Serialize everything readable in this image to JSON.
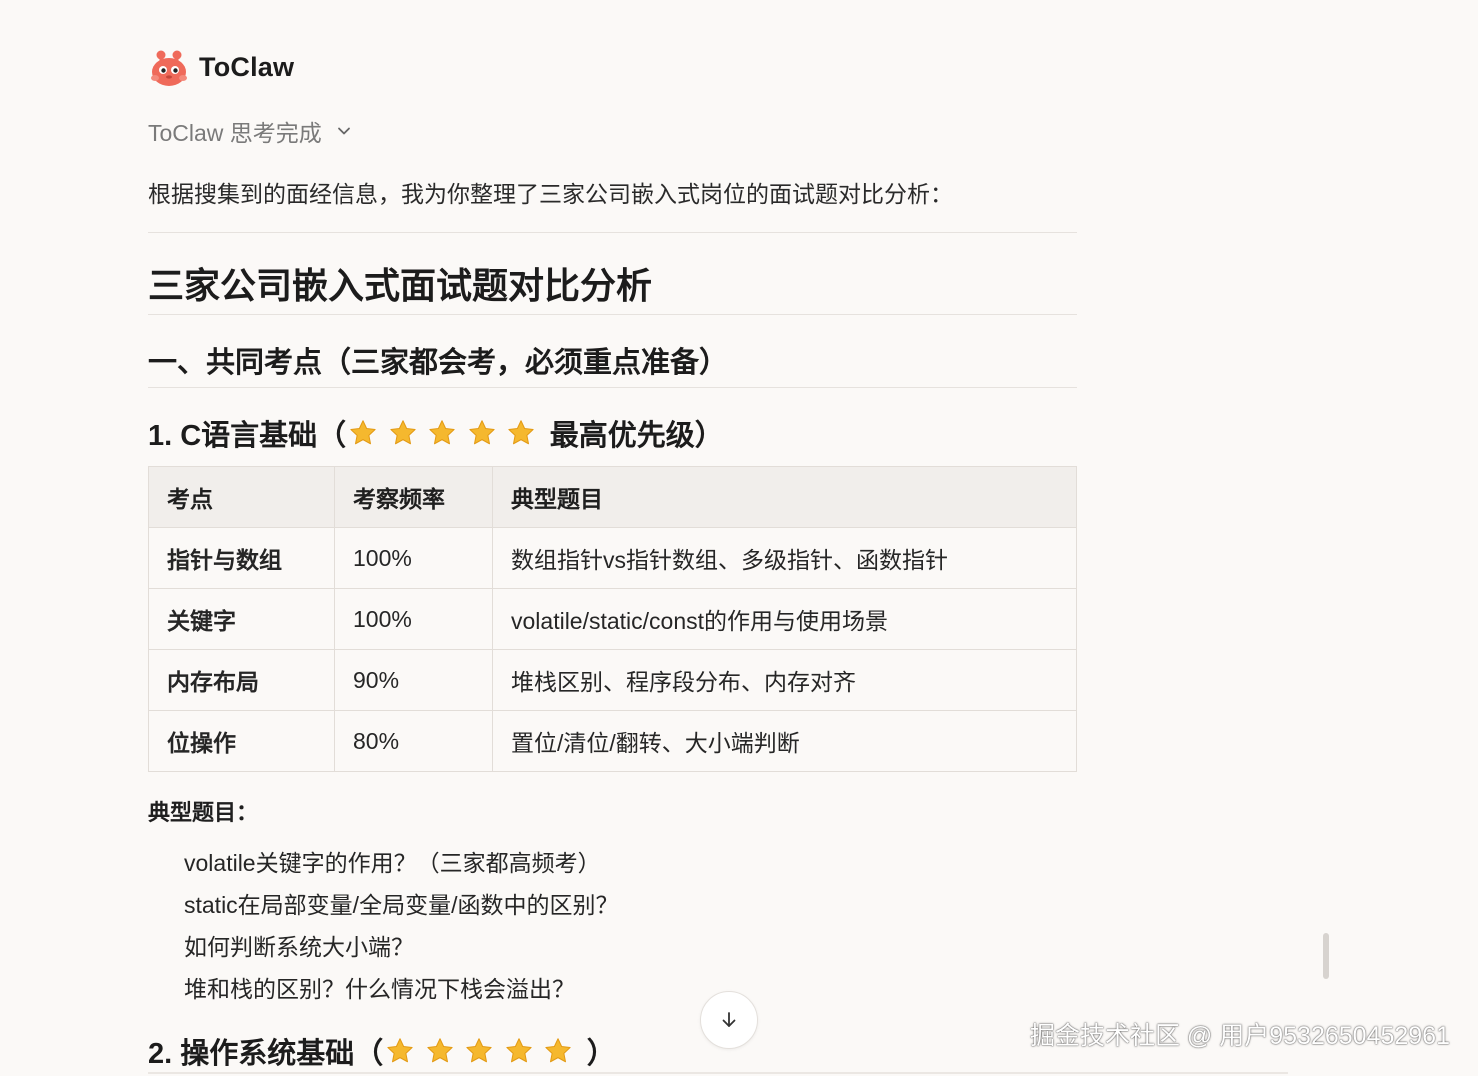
{
  "app": {
    "name": "ToClaw"
  },
  "thinking": {
    "label": "ToClaw 思考完成"
  },
  "message": {
    "intro": "根据搜集到的面经信息，我为你整理了三家公司嵌入式岗位的面试题对比分析：",
    "title": "三家公司嵌入式面试题对比分析",
    "section1": "一、共同考点（三家都会考，必须重点准备）",
    "topic1": {
      "prefix": "1. C语言基础（",
      "suffix": "最高优先级）",
      "stars": 5
    },
    "table": {
      "headers": [
        "考点",
        "考察频率",
        "典型题目"
      ],
      "rows": [
        {
          "point": "指针与数组",
          "freq": "100%",
          "example": "数组指针vs指针数组、多级指针、函数指针"
        },
        {
          "point": "关键字",
          "freq": "100%",
          "example": "volatile/static/const的作用与使用场景"
        },
        {
          "point": "内存布局",
          "freq": "90%",
          "example": "堆栈区别、程序段分布、内存对齐"
        },
        {
          "point": "位操作",
          "freq": "80%",
          "example": "置位/清位/翻转、大小端判断"
        }
      ]
    },
    "examples_label": "典型题目：",
    "questions": [
      "volatile关键字的作用？（三家都高频考）",
      "static在局部变量/全局变量/函数中的区别？",
      "如何判断系统大小端？",
      "堆和栈的区别？什么情况下栈会溢出？"
    ],
    "topic2": {
      "prefix": "2. 操作系统基础（",
      "suffix": "）",
      "stars": 5
    }
  },
  "icons": {
    "logo": "toclaw-mascot-icon",
    "chevron": "chevron-down-icon",
    "star": "star-icon",
    "scroll": "arrow-down-icon"
  },
  "watermark": "掘金技术社区 @ 用户9532650452961",
  "colors": {
    "background": "#fbf9f7",
    "star": "#f5b82e",
    "logo": "#ef6a5a"
  }
}
